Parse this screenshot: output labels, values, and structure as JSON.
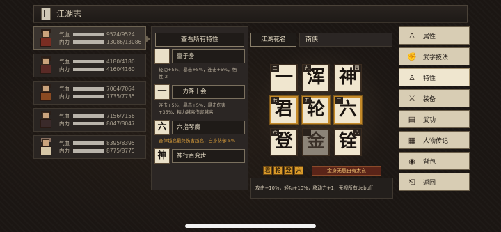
{
  "titlebar": {
    "title": "江湖志"
  },
  "characters": [
    {
      "qi_label": "气血",
      "qi": "9524/9524",
      "qi_fill": 1.0,
      "neili_label": "内力",
      "neili": "13086/13086",
      "neili_fill": 1.0
    },
    {
      "qi_label": "气血",
      "qi": "4180/4180",
      "qi_fill": 1.0,
      "neili_label": "内力",
      "neili": "4160/4160",
      "neili_fill": 1.0
    },
    {
      "qi_label": "气血",
      "qi": "7064/7064",
      "qi_fill": 1.0,
      "neili_label": "内力",
      "neili": "7735/7735",
      "neili_fill": 1.0
    },
    {
      "qi_label": "气血",
      "qi": "7156/7156",
      "qi_fill": 1.0,
      "neili_label": "内力",
      "neili": "8047/8047",
      "neili_fill": 1.0
    },
    {
      "qi_label": "气血",
      "qi": "8395/8395",
      "qi_fill": 1.0,
      "neili_label": "内力",
      "neili": "8775/8775",
      "neili_fill": 1.0
    }
  ],
  "traits_panel": {
    "view_all": "查看所有特性",
    "traits": [
      {
        "glyph": "",
        "name": "童子身",
        "desc": "轻功+5%，暴击+5%，连击+5%，悟性-2",
        "highlight": false
      },
      {
        "glyph": "一",
        "name": "一力降十会",
        "desc": "连击+5%，暴击+5%，暴击伤害+35%，精力越高伤害越高",
        "highlight": false
      },
      {
        "glyph": "六",
        "name": "六指琴魔",
        "desc": "音律越高最终伤害越高，自身防御-5%",
        "highlight": true
      },
      {
        "glyph": "神",
        "name": "神行百变步",
        "desc": "",
        "highlight": false
      }
    ]
  },
  "nickname": {
    "label": "江湖花名",
    "value": "南侠"
  },
  "grid": {
    "tiles": [
      {
        "char": "一",
        "num": "二",
        "num_side": "l",
        "style": "plain"
      },
      {
        "char": "浑",
        "num": "九",
        "num_side": "l",
        "style": "plain"
      },
      {
        "char": "神",
        "num": "四",
        "num_side": "r",
        "style": "plain"
      },
      {
        "char": "君",
        "num": "七",
        "num_side": "l",
        "style": "gold"
      },
      {
        "char": "轮",
        "num": "五",
        "num_side": "l",
        "style": "gold"
      },
      {
        "char": "六",
        "num": "三",
        "num_side": "l",
        "style": "gold"
      },
      {
        "char": "登",
        "num": "六",
        "num_side": "l",
        "style": "plain"
      },
      {
        "char": "金",
        "num": "一",
        "num_side": "l",
        "style": "dim"
      },
      {
        "char": "铨",
        "num": "八",
        "num_side": "r",
        "style": "plain"
      }
    ]
  },
  "combo": {
    "badges": [
      "君",
      "轮",
      "登",
      "六"
    ],
    "title": "金身无忌自有太玄",
    "effect": "攻击+10%，轻功+10%，移动力+1，无视所有debuff"
  },
  "menu": [
    {
      "label": "属性",
      "icon": "person-icon",
      "glyph": "♙",
      "active": false
    },
    {
      "label": "武学技法",
      "icon": "martial-arts-icon",
      "glyph": "✊",
      "active": false
    },
    {
      "label": "特性",
      "icon": "trait-icon",
      "glyph": "♙",
      "active": true
    },
    {
      "label": "装备",
      "icon": "sword-icon",
      "glyph": "⚔",
      "active": false
    },
    {
      "label": "武功",
      "icon": "scroll-icon",
      "glyph": "▤",
      "active": false
    },
    {
      "label": "人物传记",
      "icon": "book-icon",
      "glyph": "▦",
      "active": false
    },
    {
      "label": "背包",
      "icon": "bag-icon",
      "glyph": "◉",
      "active": false
    },
    {
      "label": "返回",
      "icon": "exit-icon",
      "glyph": "⎗",
      "active": false
    }
  ]
}
